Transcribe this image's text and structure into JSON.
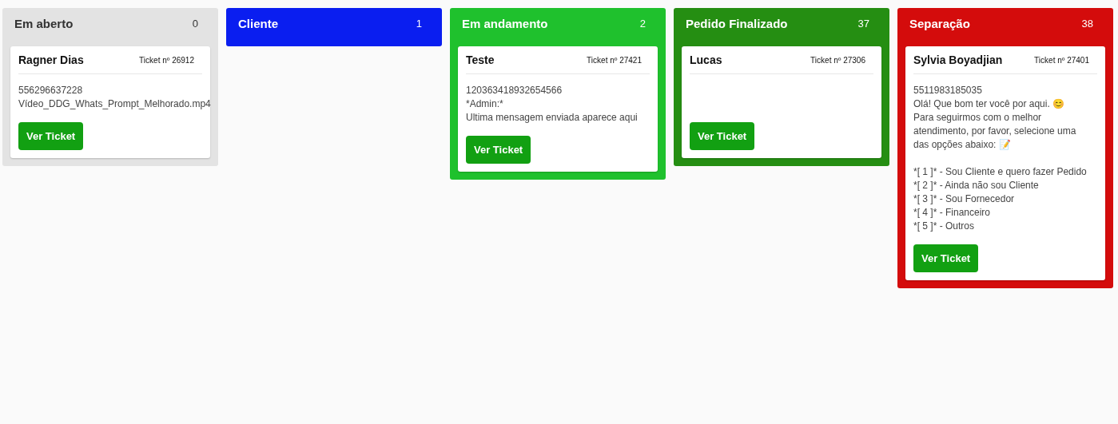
{
  "columns": [
    {
      "title": "Em aberto",
      "count": "0",
      "color": "#e3e3e3",
      "cards": [
        {
          "name": "Ragner Dias",
          "ticket": "Ticket nº 26912",
          "paragraphs": [
            [
              "556296637228",
              "Vídeo_DDG_Whats_Prompt_Melhorado.mp4"
            ]
          ],
          "button": "Ver Ticket"
        }
      ]
    },
    {
      "title": "Cliente",
      "count": "1",
      "color": "#0a1ef0"
    },
    {
      "title": "Em andamento",
      "count": "2",
      "color": "#1fc12d",
      "cards": [
        {
          "name": "Teste",
          "ticket": "Ticket nº 27421",
          "paragraphs": [
            [
              "120363418932654566",
              "*Admin:*",
              "Ultima mensagem enviada aparece aqui"
            ]
          ],
          "button": "Ver Ticket"
        }
      ]
    },
    {
      "title": "Pedido Finalizado",
      "count": "37",
      "color": "#258e12",
      "cards": [
        {
          "name": "Lucas",
          "ticket": "Ticket nº 27306",
          "button": "Ver Ticket"
        }
      ]
    },
    {
      "title": "Separação",
      "count": "38",
      "color": "#d40c0c",
      "cards": [
        {
          "name": "Sylvia Boyadjian",
          "ticket": "Ticket nº 27401",
          "paragraphs": [
            [
              "5511983185035",
              "Olá! Que bom ter você por aqui. 😊",
              "Para seguirmos com o melhor atendimento, por favor, selecione uma das opções abaixo: 📝"
            ],
            [
              "*[ 1 ]* - Sou Cliente e quero fazer Pedido",
              "*[ 2 ]* - Ainda não sou Cliente",
              "*[ 3 ]* - Sou Fornecedor",
              "*[ 4 ]* - Financeiro",
              "*[ 5 ]* - Outros"
            ]
          ],
          "button": "Ver Ticket"
        }
      ]
    }
  ]
}
